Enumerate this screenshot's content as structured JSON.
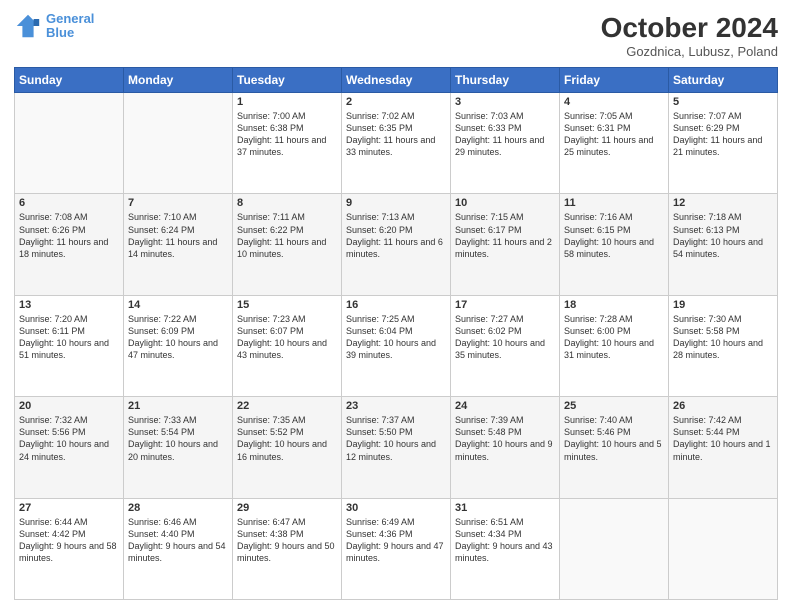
{
  "header": {
    "logo_line1": "General",
    "logo_line2": "Blue",
    "month": "October 2024",
    "location": "Gozdnica, Lubusz, Poland"
  },
  "weekdays": [
    "Sunday",
    "Monday",
    "Tuesday",
    "Wednesday",
    "Thursday",
    "Friday",
    "Saturday"
  ],
  "weeks": [
    [
      {
        "day": "",
        "info": ""
      },
      {
        "day": "",
        "info": ""
      },
      {
        "day": "1",
        "info": "Sunrise: 7:00 AM\nSunset: 6:38 PM\nDaylight: 11 hours and 37 minutes."
      },
      {
        "day": "2",
        "info": "Sunrise: 7:02 AM\nSunset: 6:35 PM\nDaylight: 11 hours and 33 minutes."
      },
      {
        "day": "3",
        "info": "Sunrise: 7:03 AM\nSunset: 6:33 PM\nDaylight: 11 hours and 29 minutes."
      },
      {
        "day": "4",
        "info": "Sunrise: 7:05 AM\nSunset: 6:31 PM\nDaylight: 11 hours and 25 minutes."
      },
      {
        "day": "5",
        "info": "Sunrise: 7:07 AM\nSunset: 6:29 PM\nDaylight: 11 hours and 21 minutes."
      }
    ],
    [
      {
        "day": "6",
        "info": "Sunrise: 7:08 AM\nSunset: 6:26 PM\nDaylight: 11 hours and 18 minutes."
      },
      {
        "day": "7",
        "info": "Sunrise: 7:10 AM\nSunset: 6:24 PM\nDaylight: 11 hours and 14 minutes."
      },
      {
        "day": "8",
        "info": "Sunrise: 7:11 AM\nSunset: 6:22 PM\nDaylight: 11 hours and 10 minutes."
      },
      {
        "day": "9",
        "info": "Sunrise: 7:13 AM\nSunset: 6:20 PM\nDaylight: 11 hours and 6 minutes."
      },
      {
        "day": "10",
        "info": "Sunrise: 7:15 AM\nSunset: 6:17 PM\nDaylight: 11 hours and 2 minutes."
      },
      {
        "day": "11",
        "info": "Sunrise: 7:16 AM\nSunset: 6:15 PM\nDaylight: 10 hours and 58 minutes."
      },
      {
        "day": "12",
        "info": "Sunrise: 7:18 AM\nSunset: 6:13 PM\nDaylight: 10 hours and 54 minutes."
      }
    ],
    [
      {
        "day": "13",
        "info": "Sunrise: 7:20 AM\nSunset: 6:11 PM\nDaylight: 10 hours and 51 minutes."
      },
      {
        "day": "14",
        "info": "Sunrise: 7:22 AM\nSunset: 6:09 PM\nDaylight: 10 hours and 47 minutes."
      },
      {
        "day": "15",
        "info": "Sunrise: 7:23 AM\nSunset: 6:07 PM\nDaylight: 10 hours and 43 minutes."
      },
      {
        "day": "16",
        "info": "Sunrise: 7:25 AM\nSunset: 6:04 PM\nDaylight: 10 hours and 39 minutes."
      },
      {
        "day": "17",
        "info": "Sunrise: 7:27 AM\nSunset: 6:02 PM\nDaylight: 10 hours and 35 minutes."
      },
      {
        "day": "18",
        "info": "Sunrise: 7:28 AM\nSunset: 6:00 PM\nDaylight: 10 hours and 31 minutes."
      },
      {
        "day": "19",
        "info": "Sunrise: 7:30 AM\nSunset: 5:58 PM\nDaylight: 10 hours and 28 minutes."
      }
    ],
    [
      {
        "day": "20",
        "info": "Sunrise: 7:32 AM\nSunset: 5:56 PM\nDaylight: 10 hours and 24 minutes."
      },
      {
        "day": "21",
        "info": "Sunrise: 7:33 AM\nSunset: 5:54 PM\nDaylight: 10 hours and 20 minutes."
      },
      {
        "day": "22",
        "info": "Sunrise: 7:35 AM\nSunset: 5:52 PM\nDaylight: 10 hours and 16 minutes."
      },
      {
        "day": "23",
        "info": "Sunrise: 7:37 AM\nSunset: 5:50 PM\nDaylight: 10 hours and 12 minutes."
      },
      {
        "day": "24",
        "info": "Sunrise: 7:39 AM\nSunset: 5:48 PM\nDaylight: 10 hours and 9 minutes."
      },
      {
        "day": "25",
        "info": "Sunrise: 7:40 AM\nSunset: 5:46 PM\nDaylight: 10 hours and 5 minutes."
      },
      {
        "day": "26",
        "info": "Sunrise: 7:42 AM\nSunset: 5:44 PM\nDaylight: 10 hours and 1 minute."
      }
    ],
    [
      {
        "day": "27",
        "info": "Sunrise: 6:44 AM\nSunset: 4:42 PM\nDaylight: 9 hours and 58 minutes."
      },
      {
        "day": "28",
        "info": "Sunrise: 6:46 AM\nSunset: 4:40 PM\nDaylight: 9 hours and 54 minutes."
      },
      {
        "day": "29",
        "info": "Sunrise: 6:47 AM\nSunset: 4:38 PM\nDaylight: 9 hours and 50 minutes."
      },
      {
        "day": "30",
        "info": "Sunrise: 6:49 AM\nSunset: 4:36 PM\nDaylight: 9 hours and 47 minutes."
      },
      {
        "day": "31",
        "info": "Sunrise: 6:51 AM\nSunset: 4:34 PM\nDaylight: 9 hours and 43 minutes."
      },
      {
        "day": "",
        "info": ""
      },
      {
        "day": "",
        "info": ""
      }
    ]
  ]
}
